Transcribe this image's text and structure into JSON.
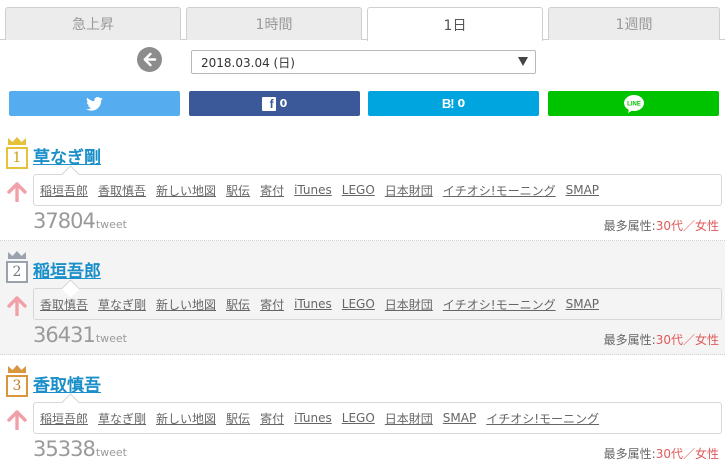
{
  "tabs": [
    {
      "label": "急上昇",
      "active": false
    },
    {
      "label": "1時間",
      "active": false
    },
    {
      "label": "1日",
      "active": true
    },
    {
      "label": "1週間",
      "active": false
    }
  ],
  "date": {
    "selected": "2018.03.04 (日)"
  },
  "share": {
    "facebook_count": "0",
    "hatena_mark": "B!",
    "hatena_count": "0",
    "line_label": "LINE"
  },
  "colors": {
    "twitter": "#55acee",
    "facebook": "#3b5998",
    "hatena": "#00a4de",
    "line": "#00c300",
    "gold": "#e7c13a",
    "silver": "#9aa3ad",
    "bronze": "#d9963c",
    "name_link": "#1a8fc9",
    "rising_arrow": "#f2a0a8"
  },
  "ranking": [
    {
      "rank": "1",
      "name": "草なぎ剛",
      "keywords": [
        "稲垣吾郎",
        "香取慎吾",
        "新しい地図",
        "駅伝",
        "寄付",
        "iTunes",
        "LEGO",
        "日本財団",
        "イチオシ!モーニング",
        "SMAP"
      ],
      "tweets": "37804",
      "tweet_unit": "tweet",
      "attr_label": "最多属性:",
      "attr_value": "30代／女性"
    },
    {
      "rank": "2",
      "name": "稲垣吾郎",
      "keywords": [
        "香取慎吾",
        "草なぎ剛",
        "新しい地図",
        "駅伝",
        "寄付",
        "iTunes",
        "LEGO",
        "日本財団",
        "イチオシ!モーニング",
        "SMAP"
      ],
      "tweets": "36431",
      "tweet_unit": "tweet",
      "attr_label": "最多属性:",
      "attr_value": "30代／女性"
    },
    {
      "rank": "3",
      "name": "香取慎吾",
      "keywords": [
        "稲垣吾郎",
        "草なぎ剛",
        "新しい地図",
        "駅伝",
        "寄付",
        "iTunes",
        "LEGO",
        "日本財団",
        "SMAP",
        "イチオシ!モーニング"
      ],
      "tweets": "35338",
      "tweet_unit": "tweet",
      "attr_label": "最多属性:",
      "attr_value": "30代／女性"
    }
  ]
}
